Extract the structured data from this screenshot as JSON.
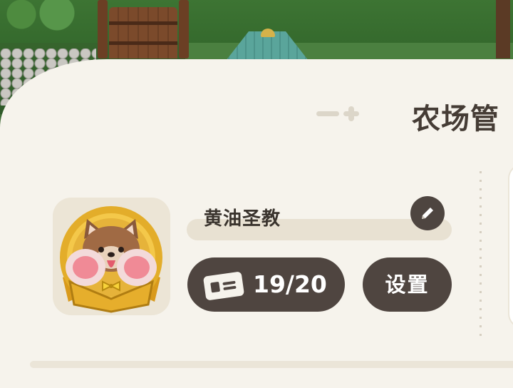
{
  "header": {
    "title": "农场管"
  },
  "profile": {
    "name": "黄油圣教",
    "avatar_icon": "shiba-dog-avatar",
    "edit_icon": "pencil-icon"
  },
  "tickets": {
    "icon": "ticket-icon",
    "count": "19/20"
  },
  "settings": {
    "label": "设置"
  },
  "colors": {
    "panel": "#f6f3ec",
    "pill": "#4f4540",
    "title": "#453c35",
    "name_bar": "#e8e1d2",
    "avatar_bg": "#ece5d6",
    "gold": "#e3ad2a"
  }
}
